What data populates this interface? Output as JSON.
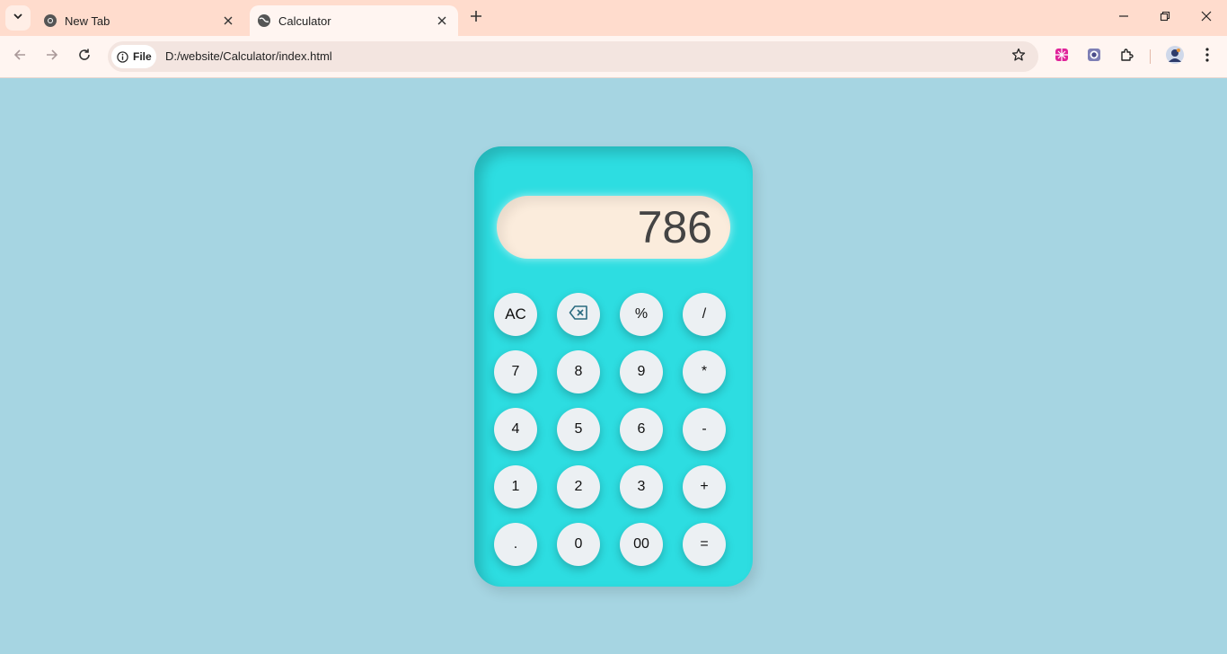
{
  "browser": {
    "tabs": [
      {
        "title": "New Tab",
        "icon": "chrome-icon"
      },
      {
        "title": "Calculator",
        "icon": "globe-icon"
      }
    ],
    "address": {
      "scheme_label": "File",
      "url": "D:/website/Calculator/index.html"
    },
    "colors": {
      "tabbar": "#ffdccd",
      "toolbar": "#fff5f1",
      "omnibox": "#f3e5e0"
    }
  },
  "calculator": {
    "display_value": "786",
    "colors": {
      "body": "#2ddde1",
      "display": "#fbecdc",
      "key": "#ecf0f3",
      "page": "#a6d5e2"
    },
    "keys": [
      "AC",
      "⌫",
      "%",
      "/",
      "7",
      "8",
      "9",
      "*",
      "4",
      "5",
      "6",
      "-",
      "1",
      "2",
      "3",
      "+",
      ".",
      "0",
      "00",
      "="
    ]
  }
}
